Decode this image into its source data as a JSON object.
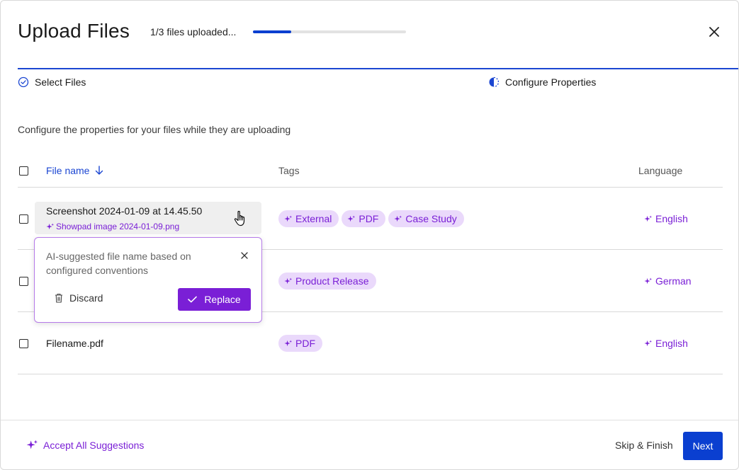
{
  "header": {
    "title": "Upload Files",
    "progress_text": "1/3 files uploaded...",
    "progress_fraction": 0.25
  },
  "steps": [
    {
      "label": "Select Files",
      "state": "complete"
    },
    {
      "label": "Configure Properties",
      "state": "in-progress"
    }
  ],
  "subtitle": "Configure the properties for your files while they are uploading",
  "table": {
    "columns": {
      "file": "File name",
      "tags": "Tags",
      "language": "Language"
    },
    "rows": [
      {
        "file_name": "Screenshot 2024-01-09 at 14.45.50",
        "ai_suggestion": "Showpad image 2024-01-09.png",
        "tags": [
          "External",
          "PDF",
          "Case Study"
        ],
        "language": "English"
      },
      {
        "file_name": "",
        "tags": [
          "Product Release"
        ],
        "language": "German"
      },
      {
        "file_name": "Filename.pdf",
        "tags": [
          "PDF"
        ],
        "language": "English"
      }
    ]
  },
  "popover": {
    "text": "AI-suggested file name based on configured conventions",
    "discard_label": "Discard",
    "replace_label": "Replace"
  },
  "footer": {
    "accept_all_label": "Accept All Suggestions",
    "skip_label": "Skip & Finish",
    "next_label": "Next"
  },
  "colors": {
    "primary": "#0a3fd0",
    "ai_purple": "#7a1fd6",
    "tag_bg": "#ead9fb"
  },
  "icons": [
    "close-icon",
    "check-circle-icon",
    "half-circle-progress-icon",
    "arrow-down-icon",
    "sparkle-icon",
    "hand-pointer-icon",
    "trash-icon",
    "check-icon"
  ]
}
